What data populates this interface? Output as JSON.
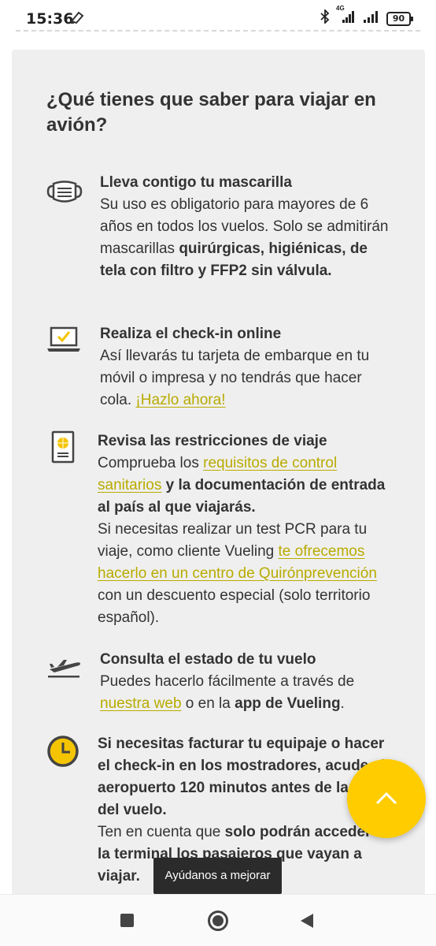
{
  "status_bar": {
    "time": "15:36",
    "network": "4G",
    "battery": "90"
  },
  "card": {
    "title": "¿Qué tienes que saber para viajar en avión?",
    "items": [
      {
        "icon": "mask-icon",
        "heading": "Lleva contigo tu mascarilla",
        "text1": "Su uso es obligatorio para mayores de 6 años en todos los vuelos. Solo se admitirán mascarillas ",
        "bold1": "quirúrgicas, higiénicas, de tela con filtro y FFP2 sin válvula."
      },
      {
        "icon": "laptop-check-icon",
        "heading": "Realiza el check-in online",
        "text1": "Así llevarás tu tarjeta de embarque en tu móvil o impresa y no tendrás que hacer cola. ",
        "link1": "¡Hazlo ahora!"
      },
      {
        "icon": "passport-icon",
        "heading": "Revisa las restricciones de viaje",
        "text1": "Comprueba los ",
        "link1": "requisitos de control sanitarios",
        "bold1": " y la documentación de entrada al país al que viajarás.",
        "text2": "Si necesitas realizar un test PCR para tu viaje, como cliente Vueling ",
        "link2": "te ofrecemos hacerlo en un centro de Quirónprevención",
        "text3": " con un descuento especial (solo territorio español)."
      },
      {
        "icon": "plane-takeoff-icon",
        "heading": "Consulta el estado de tu vuelo",
        "text1": "Puedes hacerlo fácilmente a través de ",
        "link1": "nuestra web",
        "text2": " o en la ",
        "bold1": "app de Vueling",
        "text3": "."
      },
      {
        "icon": "clock-icon",
        "bold1": "Si necesitas facturar tu equipaje o hacer el check-in en los mostradores, acude al aeropuerto 120 minutos antes de la salida del vuelo.",
        "text1": "Ten en cuenta que ",
        "bold2": "solo podrán acceder a la terminal los pasajeros que vayan a viajar."
      }
    ]
  },
  "toast": "Ayúdanos a mejorar",
  "colors": {
    "accent": "#ffcc00",
    "link": "#b8ab00",
    "card_bg": "#efefef"
  }
}
